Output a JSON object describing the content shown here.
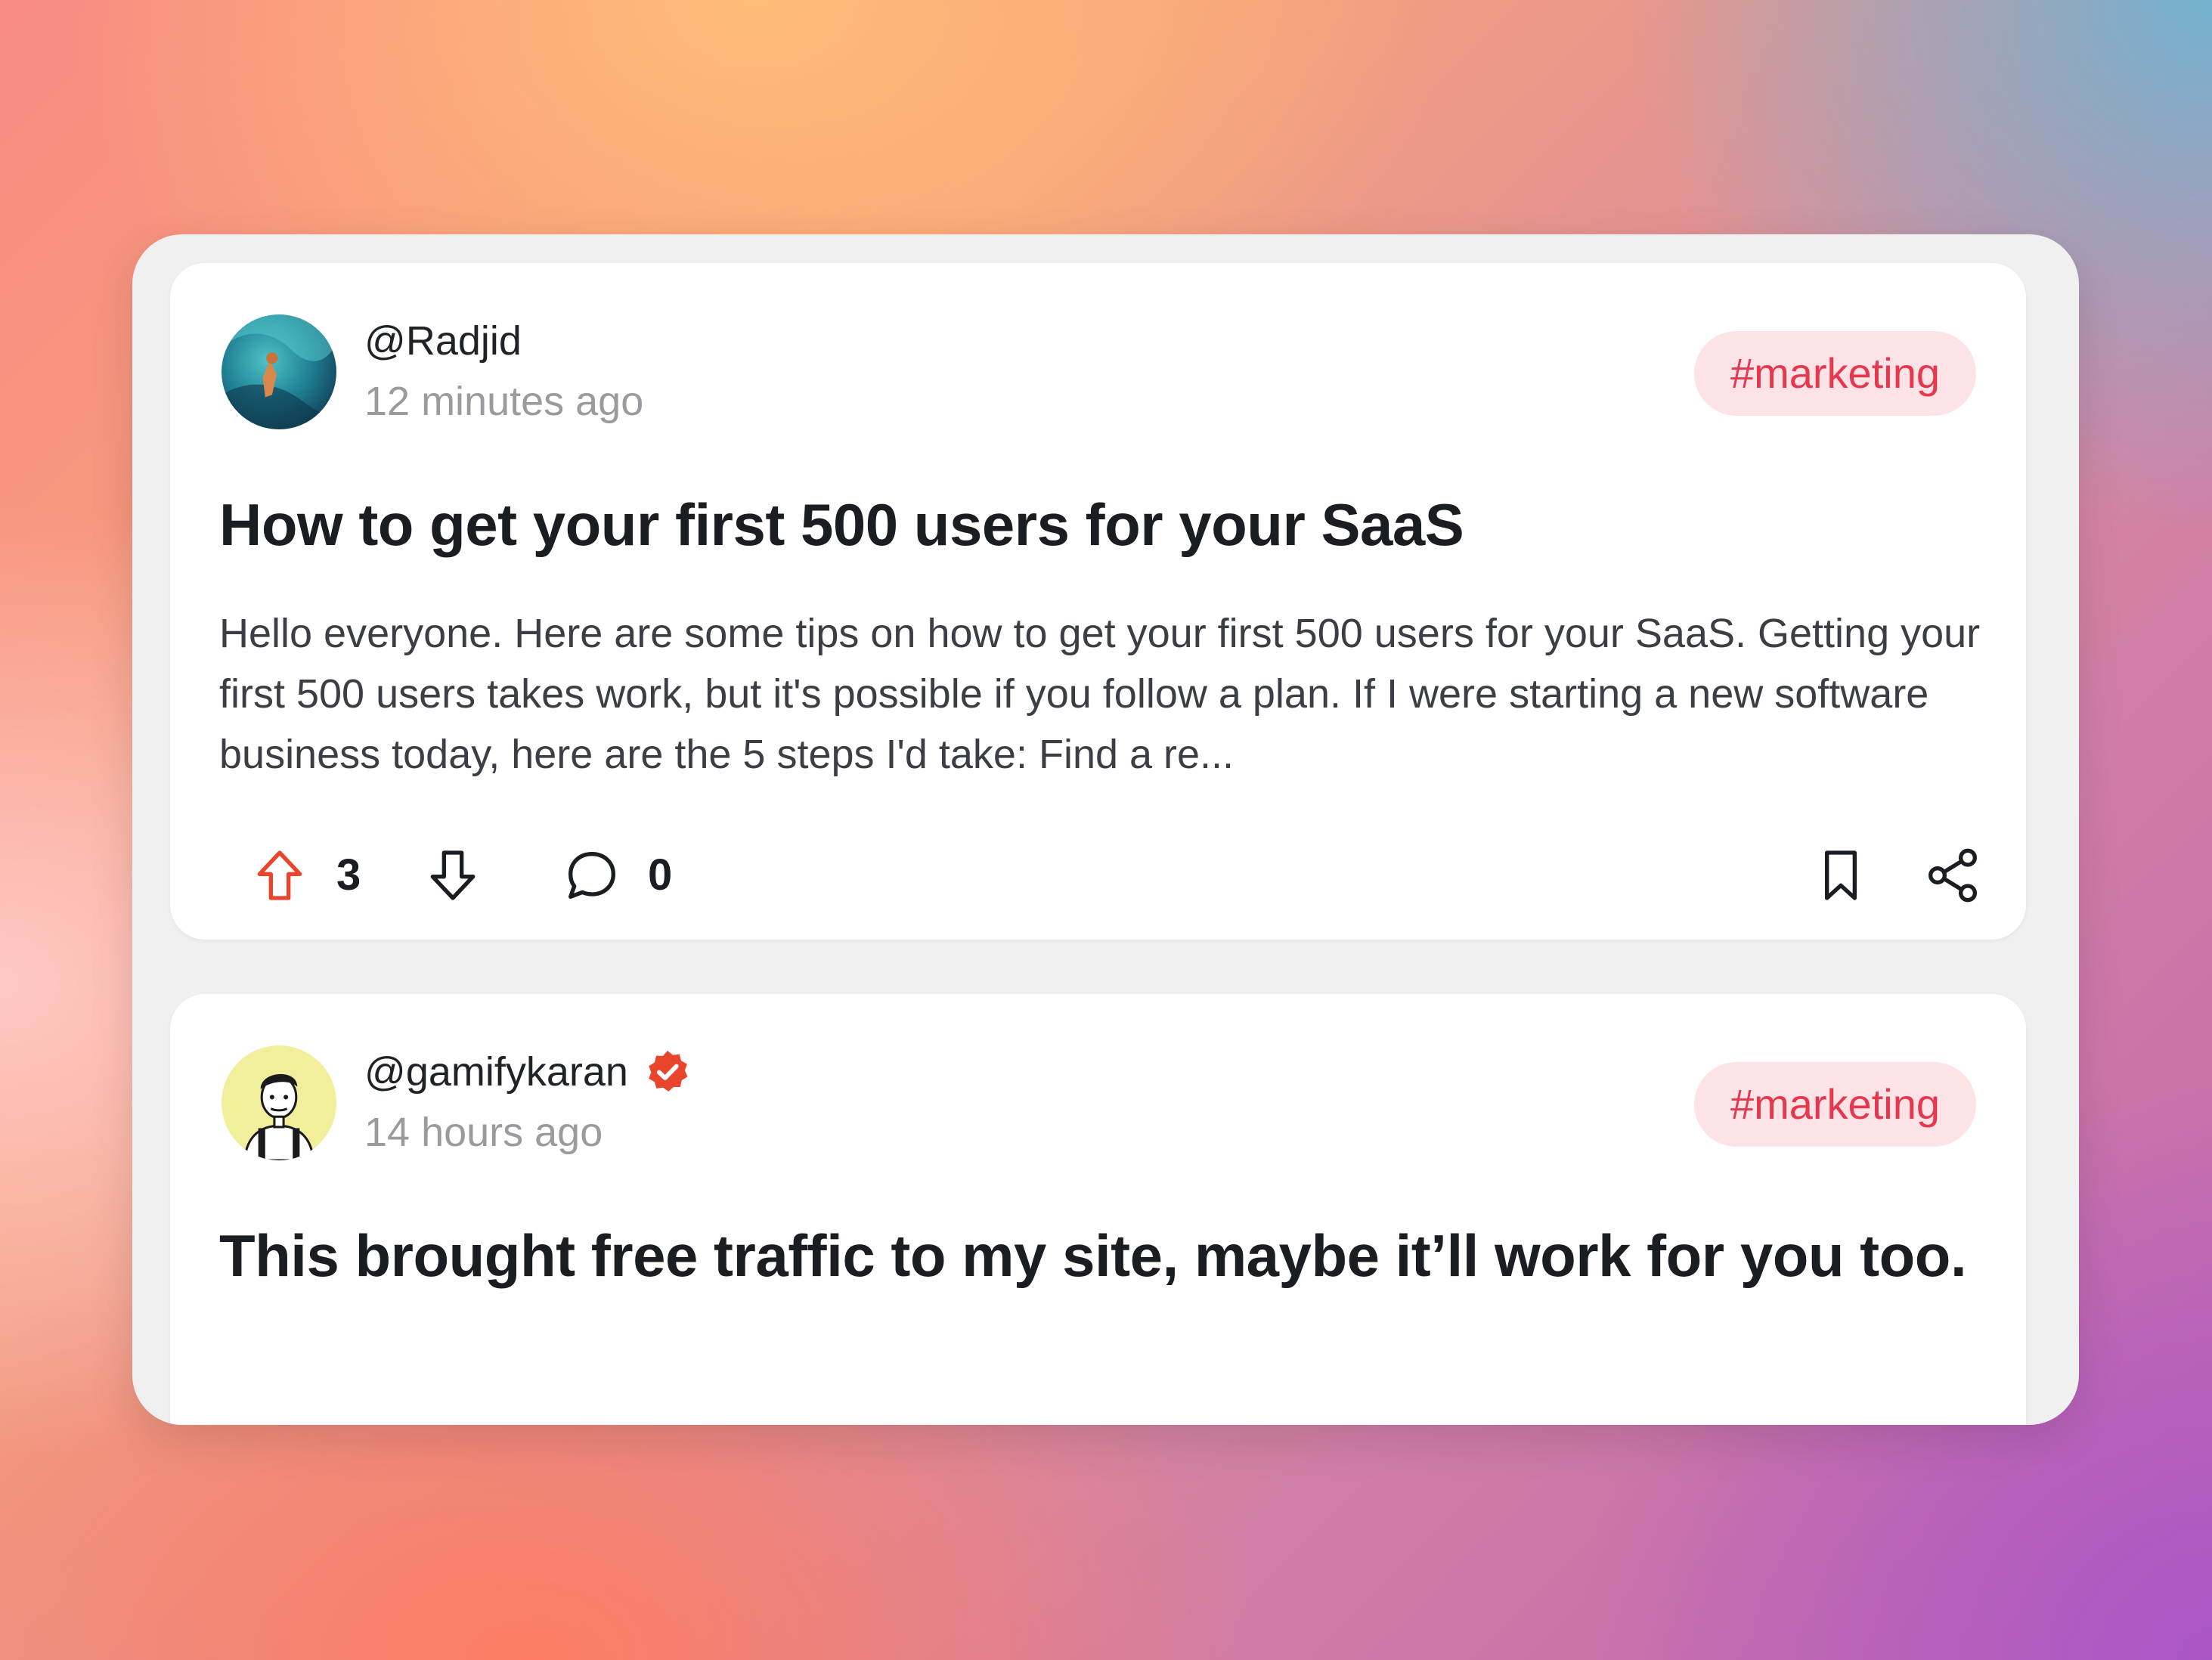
{
  "posts": [
    {
      "username": "@Radjid",
      "time": "12 minutes ago",
      "tag": "#marketing",
      "title": "How to get your first 500 users for your SaaS",
      "excerpt": "Hello everyone. Here are some tips on how to get your first 500 users for your SaaS. Getting your first 500 users takes work, but it's possible if you follow a plan. If I were starting a new software business today, here are the 5 steps I'd take: Find a re...",
      "upvotes": "3",
      "comments": "0"
    },
    {
      "username": "@gamifykaran",
      "verified": true,
      "time": "14 hours ago",
      "tag": "#marketing",
      "title": "This brought free traffic to my site, maybe it’ll work for you too."
    }
  ],
  "colors": {
    "tag_bg": "#fde3e5",
    "tag_text": "#e5384f",
    "upvote_active": "#e8452c",
    "verified_badge": "#e8452c"
  },
  "icons": [
    "upvote-icon",
    "downvote-icon",
    "comment-icon",
    "bookmark-icon",
    "share-icon",
    "verified-icon"
  ]
}
